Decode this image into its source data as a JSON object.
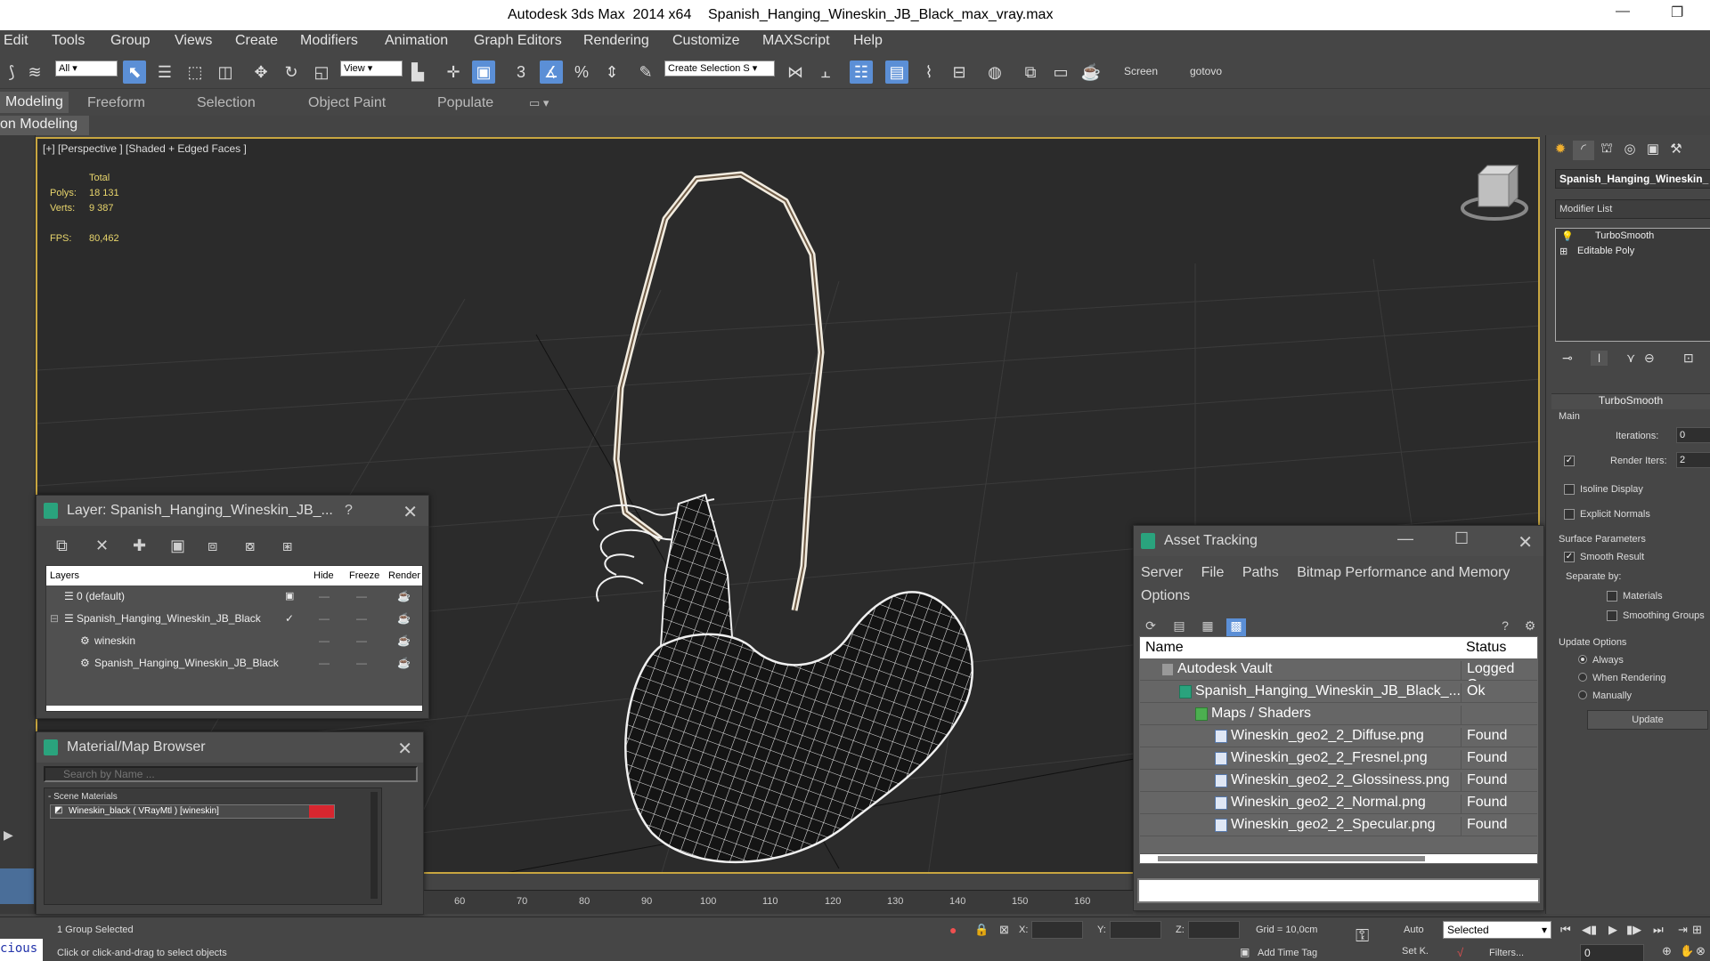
{
  "window": {
    "app_title": "Autodesk 3ds Max  2014 x64",
    "file_name": "Spanish_Hanging_Wineskin_JB_Black_max_vray.max",
    "minimize_glyph": "—",
    "maximize_glyph": "❐"
  },
  "menu": {
    "edit": "Edit",
    "tools": "Tools",
    "group": "Group",
    "views": "Views",
    "create": "Create",
    "modifiers": "Modifiers",
    "animation": "Animation",
    "graph_editors": "Graph Editors",
    "rendering": "Rendering",
    "customize": "Customize",
    "maxscript": "MAXScript",
    "help": "Help"
  },
  "toolbar": {
    "filter_value": "All",
    "view_value": "View",
    "selection_set_value": "Create Selection S",
    "snap_label": "3",
    "percent_label": "%",
    "screen_label": "Screen",
    "gotovo_label": "gotovo"
  },
  "ribbon": {
    "tab_modeling": "Modeling",
    "tab_freeform": "Freeform",
    "tab_selection": "Selection",
    "tab_object_paint": "Object Paint",
    "tab_populate": "Populate",
    "sub_label": "on Modeling"
  },
  "viewport": {
    "label": "[+] [Perspective ] [Shaded + Edged Faces ]",
    "stats_header": "Total",
    "polys_label": "Polys:",
    "polys_value": "18 131",
    "verts_label": "Verts:",
    "verts_value": "9 387",
    "fps_label": "FPS:",
    "fps_value": "80,462"
  },
  "layer_dialog": {
    "title": "Layer: Spanish_Hanging_Wineskin_JB_...",
    "help": "?",
    "columns": {
      "layers": "Layers",
      "hide": "Hide",
      "freeze": "Freeze",
      "render": "Render"
    },
    "rows": [
      {
        "name": "0 (default)"
      },
      {
        "name": "Spanish_Hanging_Wineskin_JB_Black"
      },
      {
        "name": "wineskin"
      },
      {
        "name": "Spanish_Hanging_Wineskin_JB_Black"
      }
    ]
  },
  "material_browser": {
    "title": "Material/Map Browser",
    "search_placeholder": "Search by Name ...",
    "group": "- Scene Materials",
    "item": "Wineskin_black  ( VRayMtl )  [wineskin]",
    "swatch_color": "#d8262f"
  },
  "asset_tracking": {
    "title": "Asset Tracking",
    "menu": {
      "server": "Server",
      "file": "File",
      "paths": "Paths",
      "bitmap": "Bitmap Performance and Memory",
      "options": "Options"
    },
    "columns": {
      "name": "Name",
      "status": "Status"
    },
    "rows": [
      {
        "name": "Autodesk Vault",
        "status": "Logged O..."
      },
      {
        "name": "Spanish_Hanging_Wineskin_JB_Black_...",
        "status": "Ok"
      },
      {
        "name": "Maps / Shaders",
        "status": ""
      },
      {
        "name": "Wineskin_geo2_2_Diffuse.png",
        "status": "Found"
      },
      {
        "name": "Wineskin_geo2_2_Fresnel.png",
        "status": "Found"
      },
      {
        "name": "Wineskin_geo2_2_Glossiness.png",
        "status": "Found"
      },
      {
        "name": "Wineskin_geo2_2_Normal.png",
        "status": "Found"
      },
      {
        "name": "Wineskin_geo2_2_Specular.png",
        "status": "Found"
      }
    ]
  },
  "command_panel": {
    "object_name": "Spanish_Hanging_Wineskin_",
    "modifier_list": "Modifier List",
    "stack": [
      "TurboSmooth",
      "Editable Poly"
    ],
    "rollout_title": "TurboSmooth",
    "main_label": "Main",
    "iterations_label": "Iterations:",
    "iterations_value": "0",
    "render_iters_label": "Render Iters:",
    "render_iters_value": "2",
    "isoline_label": "Isoline Display",
    "explicit_normals_label": "Explicit Normals",
    "surface_params_label": "Surface Parameters",
    "smooth_result_label": "Smooth Result",
    "separate_by_label": "Separate by:",
    "materials_label": "Materials",
    "smoothing_groups_label": "Smoothing Groups",
    "update_options_label": "Update Options",
    "always_label": "Always",
    "when_rendering_label": "When Rendering",
    "manually_label": "Manually",
    "update_button": "Update"
  },
  "timeline": {
    "ticks": [
      "60",
      "70",
      "80",
      "90",
      "100",
      "110",
      "120",
      "130",
      "140",
      "150",
      "160"
    ]
  },
  "status": {
    "selection": "1 Group Selected",
    "prompt": "Click or click-and-drag to select objects",
    "x_label": "X:",
    "y_label": "Y:",
    "z_label": "Z:",
    "grid": "Grid = 10,0cm",
    "add_time_tag": "Add Time Tag",
    "auto": "Auto",
    "selected": "Selected",
    "set_key": "Set K.",
    "filters": "Filters...",
    "frame_value": "0",
    "script_text": "cious"
  }
}
